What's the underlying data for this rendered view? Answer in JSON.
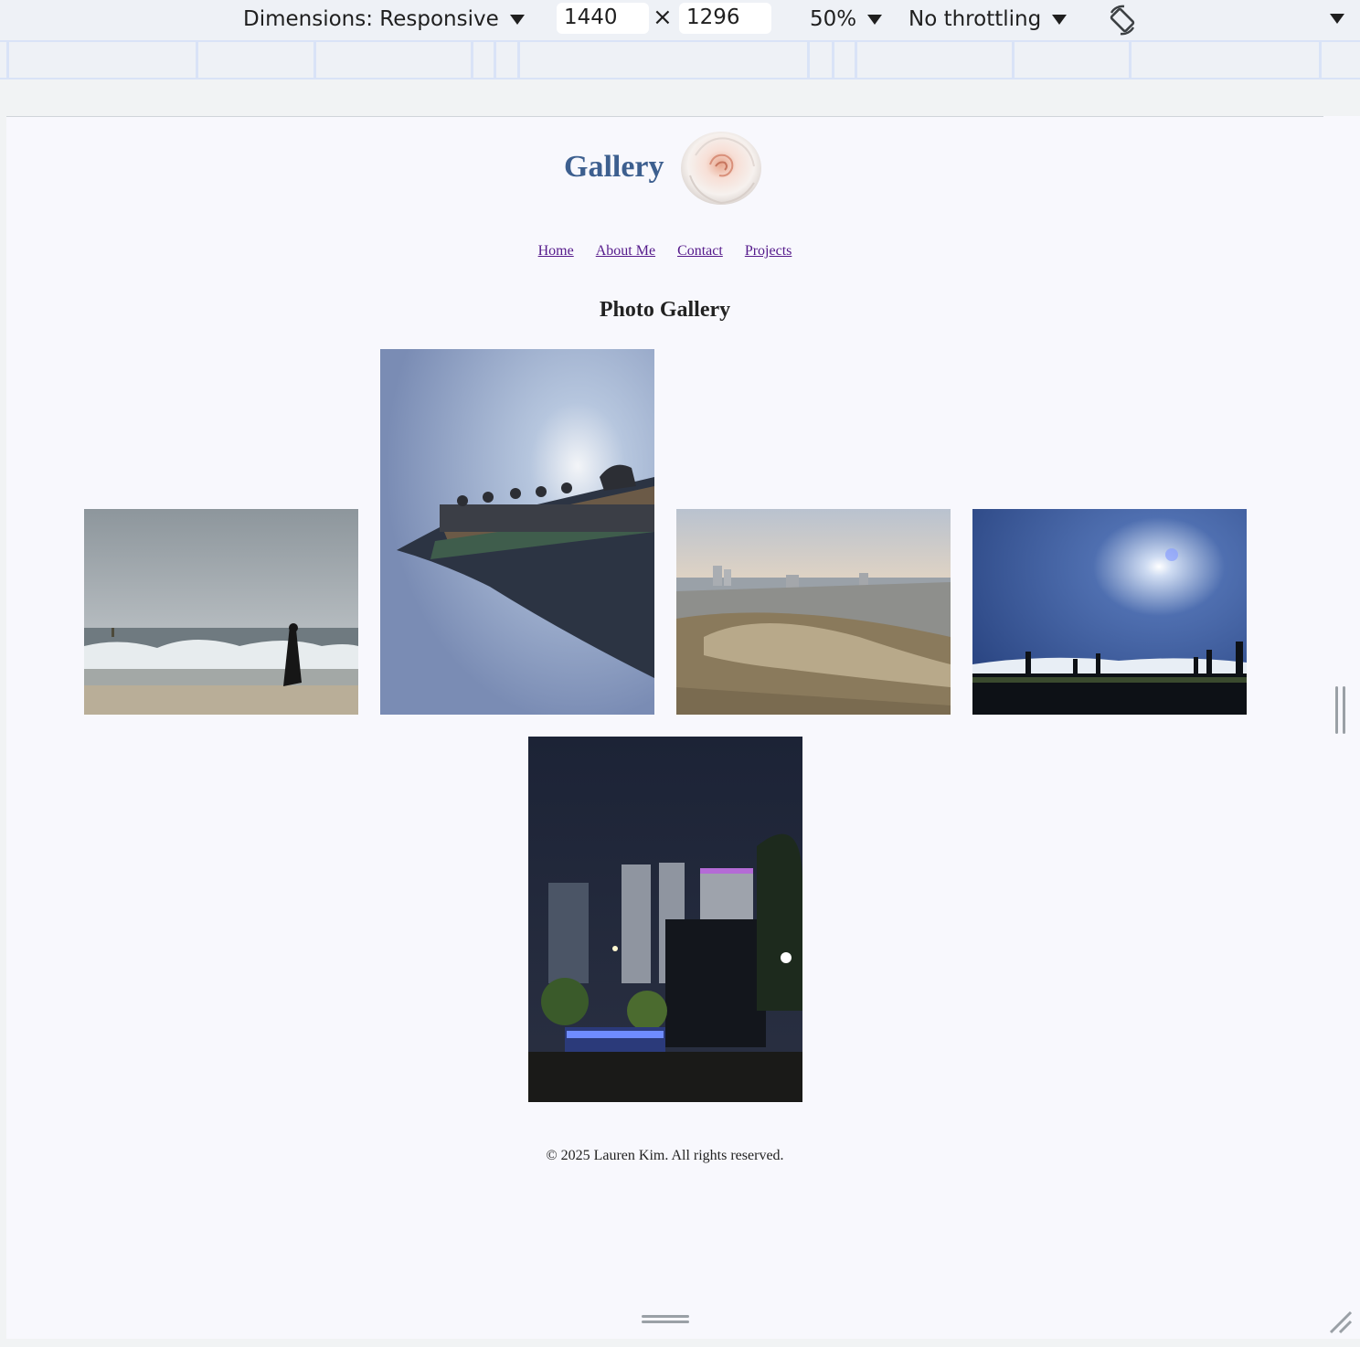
{
  "devtools": {
    "dimensions_label": "Dimensions: Responsive",
    "width_value": "1440",
    "height_value": "1296",
    "times_symbol": "×",
    "zoom_label": "50%",
    "throttling_label": "No throttling"
  },
  "site": {
    "title": "Gallery",
    "nav": [
      "Home",
      "About Me",
      "Contact",
      "Projects"
    ],
    "section_title": "Photo Gallery",
    "footer": "© 2025 Lauren Kim. All rights reserved."
  },
  "colors": {
    "title_blue": "#3d5f8f",
    "link_visited": "#551a8b",
    "page_bg": "#f8f8fd"
  },
  "photos": [
    {
      "name": "beach-waves-photo"
    },
    {
      "name": "palace-roof-photo"
    },
    {
      "name": "city-hill-photo"
    },
    {
      "name": "sun-silhouettes-photo"
    },
    {
      "name": "night-city-photo"
    }
  ]
}
